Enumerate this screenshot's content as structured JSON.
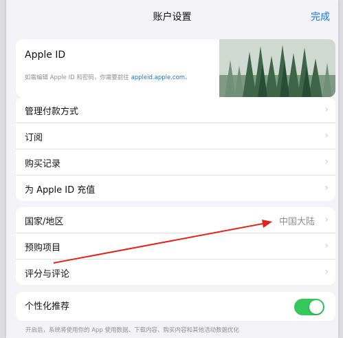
{
  "nav": {
    "title": "账户设置",
    "done_label": "完成"
  },
  "apple_id": {
    "label": "Apple ID",
    "note_prefix": "如需编辑 Apple ID 和密码，你需要前往",
    "note_link": "appleid.apple.com",
    "note_suffix": "。"
  },
  "group1": [
    {
      "label": "管理付款方式"
    },
    {
      "label": "订阅"
    },
    {
      "label": "购买记录"
    },
    {
      "label": "为 Apple ID 充值"
    }
  ],
  "group2": [
    {
      "label": "国家/地区",
      "value": "中国大陆"
    },
    {
      "label": "预购项目"
    },
    {
      "label": "评分与评论"
    }
  ],
  "personalization": {
    "label": "个性化推荐",
    "enabled": true
  },
  "footnote": "开启后，系统将使用你的 App 使用数据、下载内容、购买内容和其他活动数据优化",
  "colors": {
    "accent": "#1a73e8",
    "toggle_on": "#34c759",
    "annotation_arrow": "#e0241b"
  },
  "icons": {
    "chevron": "chevron-right-icon",
    "arrow": "annotation-arrow"
  }
}
